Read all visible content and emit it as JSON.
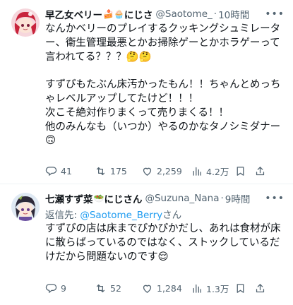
{
  "tweets": [
    {
      "name": "早乙女ベリー",
      "name_emoji": "🍰🧁",
      "name_suffix": "にじさ",
      "handle": "@Saotome_",
      "separator": "·",
      "time": "10時間",
      "body": "なんかベリーのプレイするクッキングシュミレーター、衛生管理最悪とかお掃除ゲーとかホラゲーって言われてる？？？🤔🤔\n\nすずぴもたぶん床汚かったもん！！ちゃんとめっちゃレベルアップしてたけど！！！\n次こそ絶対作りまくって売りまくる！！\n他のみんなも（いつか）やるのかなタノシミダナー🙃",
      "stats": {
        "replies": "41",
        "retweets": "175",
        "likes": "2,259",
        "views": "4.2万"
      }
    },
    {
      "name": "七瀬すず菜",
      "name_emoji": "🥗",
      "name_suffix": "にじさん",
      "handle": "@Suzuna_Nana",
      "separator": "·",
      "time": "9時間",
      "reply_prefix": "返信先: ",
      "reply_handle": "@Saotome_Berry",
      "reply_suffix": "さん",
      "body": "すずぴの店は床までぴかぴかだし、あれは食材が床に散らばっているのではなく、ストックしているだけだから問題ないのです😌",
      "stats": {
        "replies": "9",
        "retweets": "52",
        "likes": "1,284",
        "views": "1.3万"
      }
    }
  ],
  "icons": [
    "reply-icon",
    "retweet-icon",
    "like-icon",
    "views-icon",
    "bookmark-icon",
    "share-icon",
    "more-icon"
  ]
}
